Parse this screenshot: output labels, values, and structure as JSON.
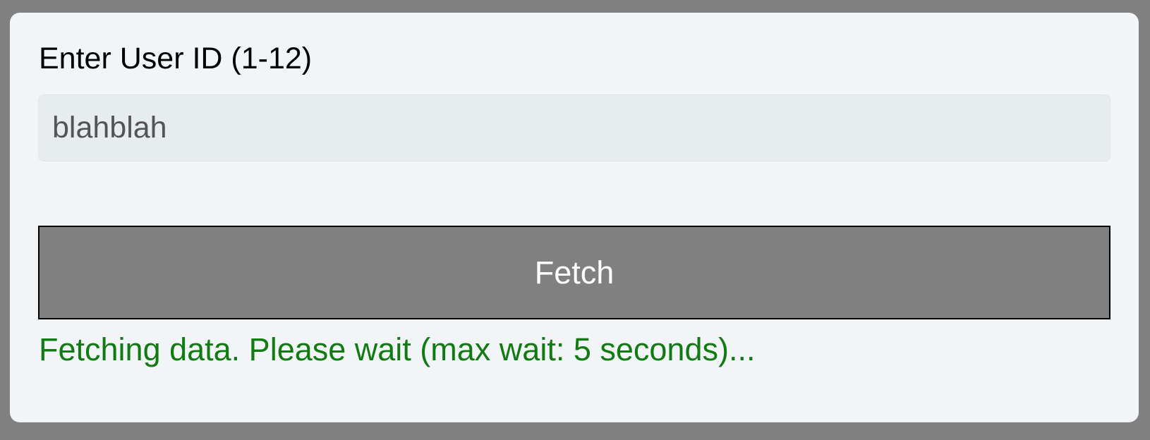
{
  "form": {
    "label": "Enter User ID (1-12)",
    "input_value": "blahblah",
    "button_label": "Fetch",
    "status_text": "Fetching data. Please wait (max wait: 5 seconds)..."
  },
  "colors": {
    "page_background": "#808080",
    "card_background": "#f2f5f7",
    "input_background": "#e7ecef",
    "button_background": "#808080",
    "button_text": "#ffffff",
    "status_text": "#127a12"
  }
}
